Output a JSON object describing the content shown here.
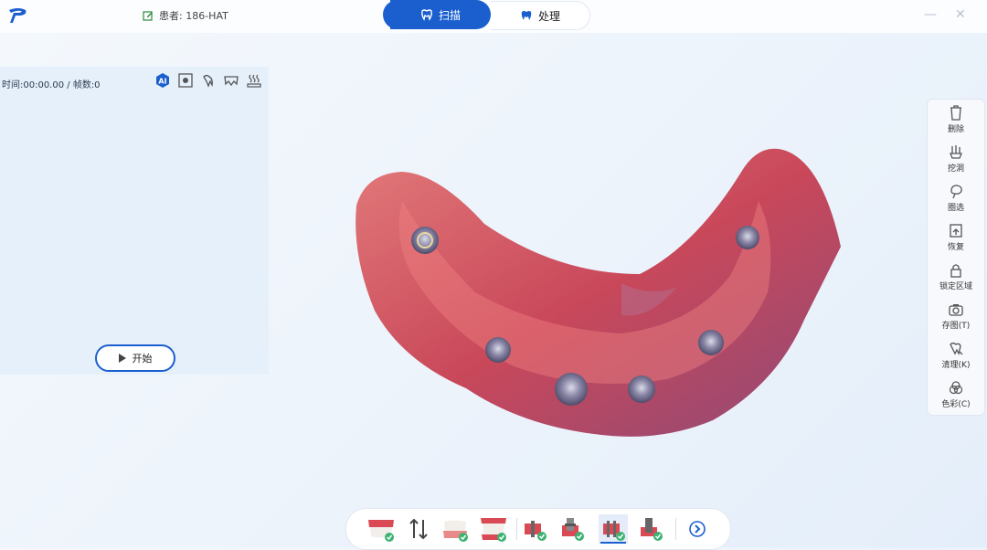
{
  "header": {
    "patient_label": "患者: 186-HAT",
    "tabs": [
      {
        "label": "扫描",
        "active": true
      },
      {
        "label": "处理",
        "active": false
      }
    ],
    "window_controls": {
      "minimize": "—",
      "close": "✕"
    }
  },
  "scan_panel": {
    "status": "时间:00:00.00 / 帧数:0",
    "toolbar_icons": [
      "ai-icon",
      "focus-icon",
      "tooth-icon",
      "teeth-icon",
      "heater-icon"
    ],
    "start_label": "开始"
  },
  "side_tools": [
    {
      "label": "删除",
      "icon": "trash-icon"
    },
    {
      "label": "挖洞",
      "icon": "dig-icon"
    },
    {
      "label": "圈选",
      "icon": "lasso-icon"
    },
    {
      "label": "恢复",
      "icon": "restore-icon"
    },
    {
      "label": "锁定区域",
      "icon": "lock-icon"
    },
    {
      "label": "存图(T)",
      "icon": "camera-icon"
    },
    {
      "label": "清理(K)",
      "icon": "clean-icon"
    },
    {
      "label": "色彩(C)",
      "icon": "color-icon"
    }
  ],
  "bottom_steps": [
    {
      "icon": "upper-jaw-icon",
      "done": true
    },
    {
      "icon": "swap-icon",
      "done": false
    },
    {
      "icon": "lower-jaw-icon",
      "done": true
    },
    {
      "icon": "bite-icon",
      "done": true
    },
    {
      "icon": "scanbody-upper-icon",
      "done": true
    },
    {
      "icon": "scanbody-post-icon",
      "done": true
    },
    {
      "icon": "scanbody-lower-icon",
      "done": true,
      "active": true
    },
    {
      "icon": "scanbody-mixed-icon",
      "done": true
    },
    {
      "icon": "next-arrow-icon",
      "done": false
    }
  ],
  "colors": {
    "accent": "#1b5fcf",
    "panel_bg": "#e6f0fb",
    "gum": "#d9605e",
    "check": "#3cb371"
  }
}
